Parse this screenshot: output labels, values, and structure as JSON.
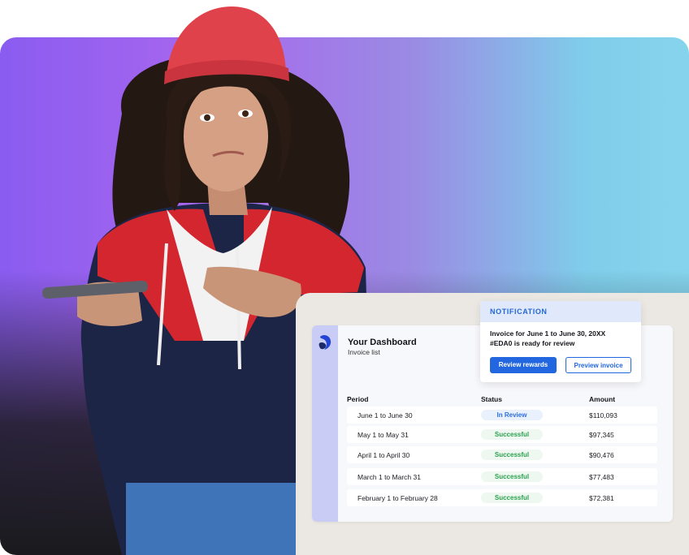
{
  "notification": {
    "heading": "NOTIFICATION",
    "message_line1": "Invoice for June 1 to June 30, 20XX",
    "message_line2": "#EDA0 is ready for review",
    "primary_button": "Review rewards",
    "secondary_button": "Preview invoice"
  },
  "dashboard": {
    "title": "Your Dashboard",
    "subtitle": "Invoice list",
    "columns": {
      "period": "Period",
      "status": "Status",
      "amount": "Amount"
    },
    "rows": [
      {
        "period": "June 1 to June 30",
        "status": "In Review",
        "amount": "$110,093"
      },
      {
        "period": "May 1 to May 31",
        "status": "Successful",
        "amount": "$97,345"
      },
      {
        "period": "April 1 to April 30",
        "status": "Successful",
        "amount": "$90,476"
      },
      {
        "period": "March 1 to March 31",
        "status": "Successful",
        "amount": "$77,483"
      },
      {
        "period": "February 1 to February 28",
        "status": "Successful",
        "amount": "$72,381"
      }
    ]
  },
  "colors": {
    "accent": "#2266e0",
    "success": "#2ca24f",
    "rail": "#c9cdf6",
    "panel": "#ebe7e2"
  },
  "icons": {
    "brand": "brand-logo-icon"
  }
}
